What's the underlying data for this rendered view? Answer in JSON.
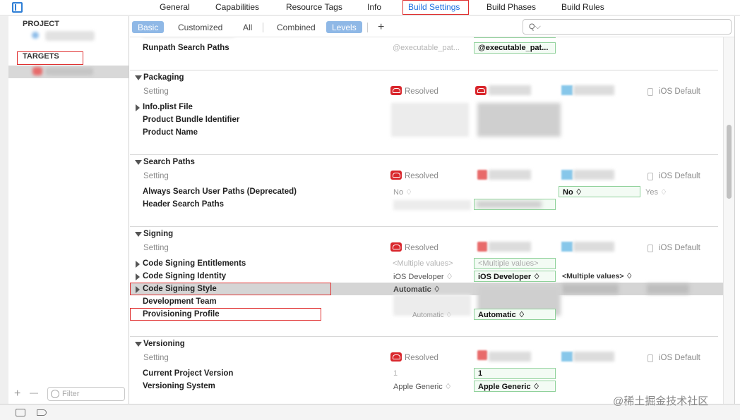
{
  "toolbar": {
    "tabs": [
      {
        "label": "General"
      },
      {
        "label": "Capabilities"
      },
      {
        "label": "Resource Tags"
      },
      {
        "label": "Info"
      },
      {
        "label": "Build Settings",
        "active": true
      },
      {
        "label": "Build Phases"
      },
      {
        "label": "Build Rules"
      }
    ]
  },
  "sidebar": {
    "project_header": "PROJECT",
    "targets_header": "TARGETS",
    "add_button": "+",
    "remove_button": "—",
    "filter_placeholder": "Filter"
  },
  "filterbar": {
    "basic": "Basic",
    "customized": "Customized",
    "all": "All",
    "combined": "Combined",
    "levels": "Levels",
    "add": "+",
    "search_icon": "Q⌵"
  },
  "columns": {
    "setting": "Setting",
    "resolved": "Resolved",
    "ios_default": "iOS Default"
  },
  "linking": {
    "row_label": "Runpath Search Paths",
    "resolved": "@executable_pat...",
    "target": "@executable_pat..."
  },
  "packaging": {
    "title": "Packaging",
    "rows": [
      {
        "label": "Info.plist File"
      },
      {
        "label": "Product Bundle Identifier"
      },
      {
        "label": "Product Name"
      }
    ]
  },
  "search_paths": {
    "title": "Search Paths",
    "rows": [
      {
        "label": "Always Search User Paths (Deprecated)",
        "resolved": "No ♢",
        "target": "No ♢",
        "default": "Yes ♢"
      },
      {
        "label": "Header Search Paths"
      }
    ]
  },
  "signing": {
    "title": "Signing",
    "rows": [
      {
        "label": "Code Signing Entitlements",
        "resolved": "<Multiple values>",
        "target": "<Multiple values>"
      },
      {
        "label": "Code Signing Identity",
        "resolved": "iOS Developer ♢",
        "target": "iOS Developer ♢",
        "project": "<Multiple values> ♢"
      },
      {
        "label": "Code Signing Style",
        "resolved": "Automatic ♢"
      },
      {
        "label": "Development Team"
      },
      {
        "label": "Provisioning Profile",
        "resolved": "Automatic ♢",
        "target": "Automatic ♢"
      }
    ]
  },
  "versioning": {
    "title": "Versioning",
    "rows": [
      {
        "label": "Current Project Version",
        "resolved": "1",
        "target": "1"
      },
      {
        "label": "Versioning System",
        "resolved": "Apple Generic ♢",
        "target": "Apple Generic ♢"
      }
    ]
  },
  "watermark": "@稀土掘金技术社区",
  "colors": {
    "accent": "#1a6fe0",
    "highlight": "#e03030",
    "level_on": "#8fb8e6",
    "green_border": "#8fd19a"
  }
}
